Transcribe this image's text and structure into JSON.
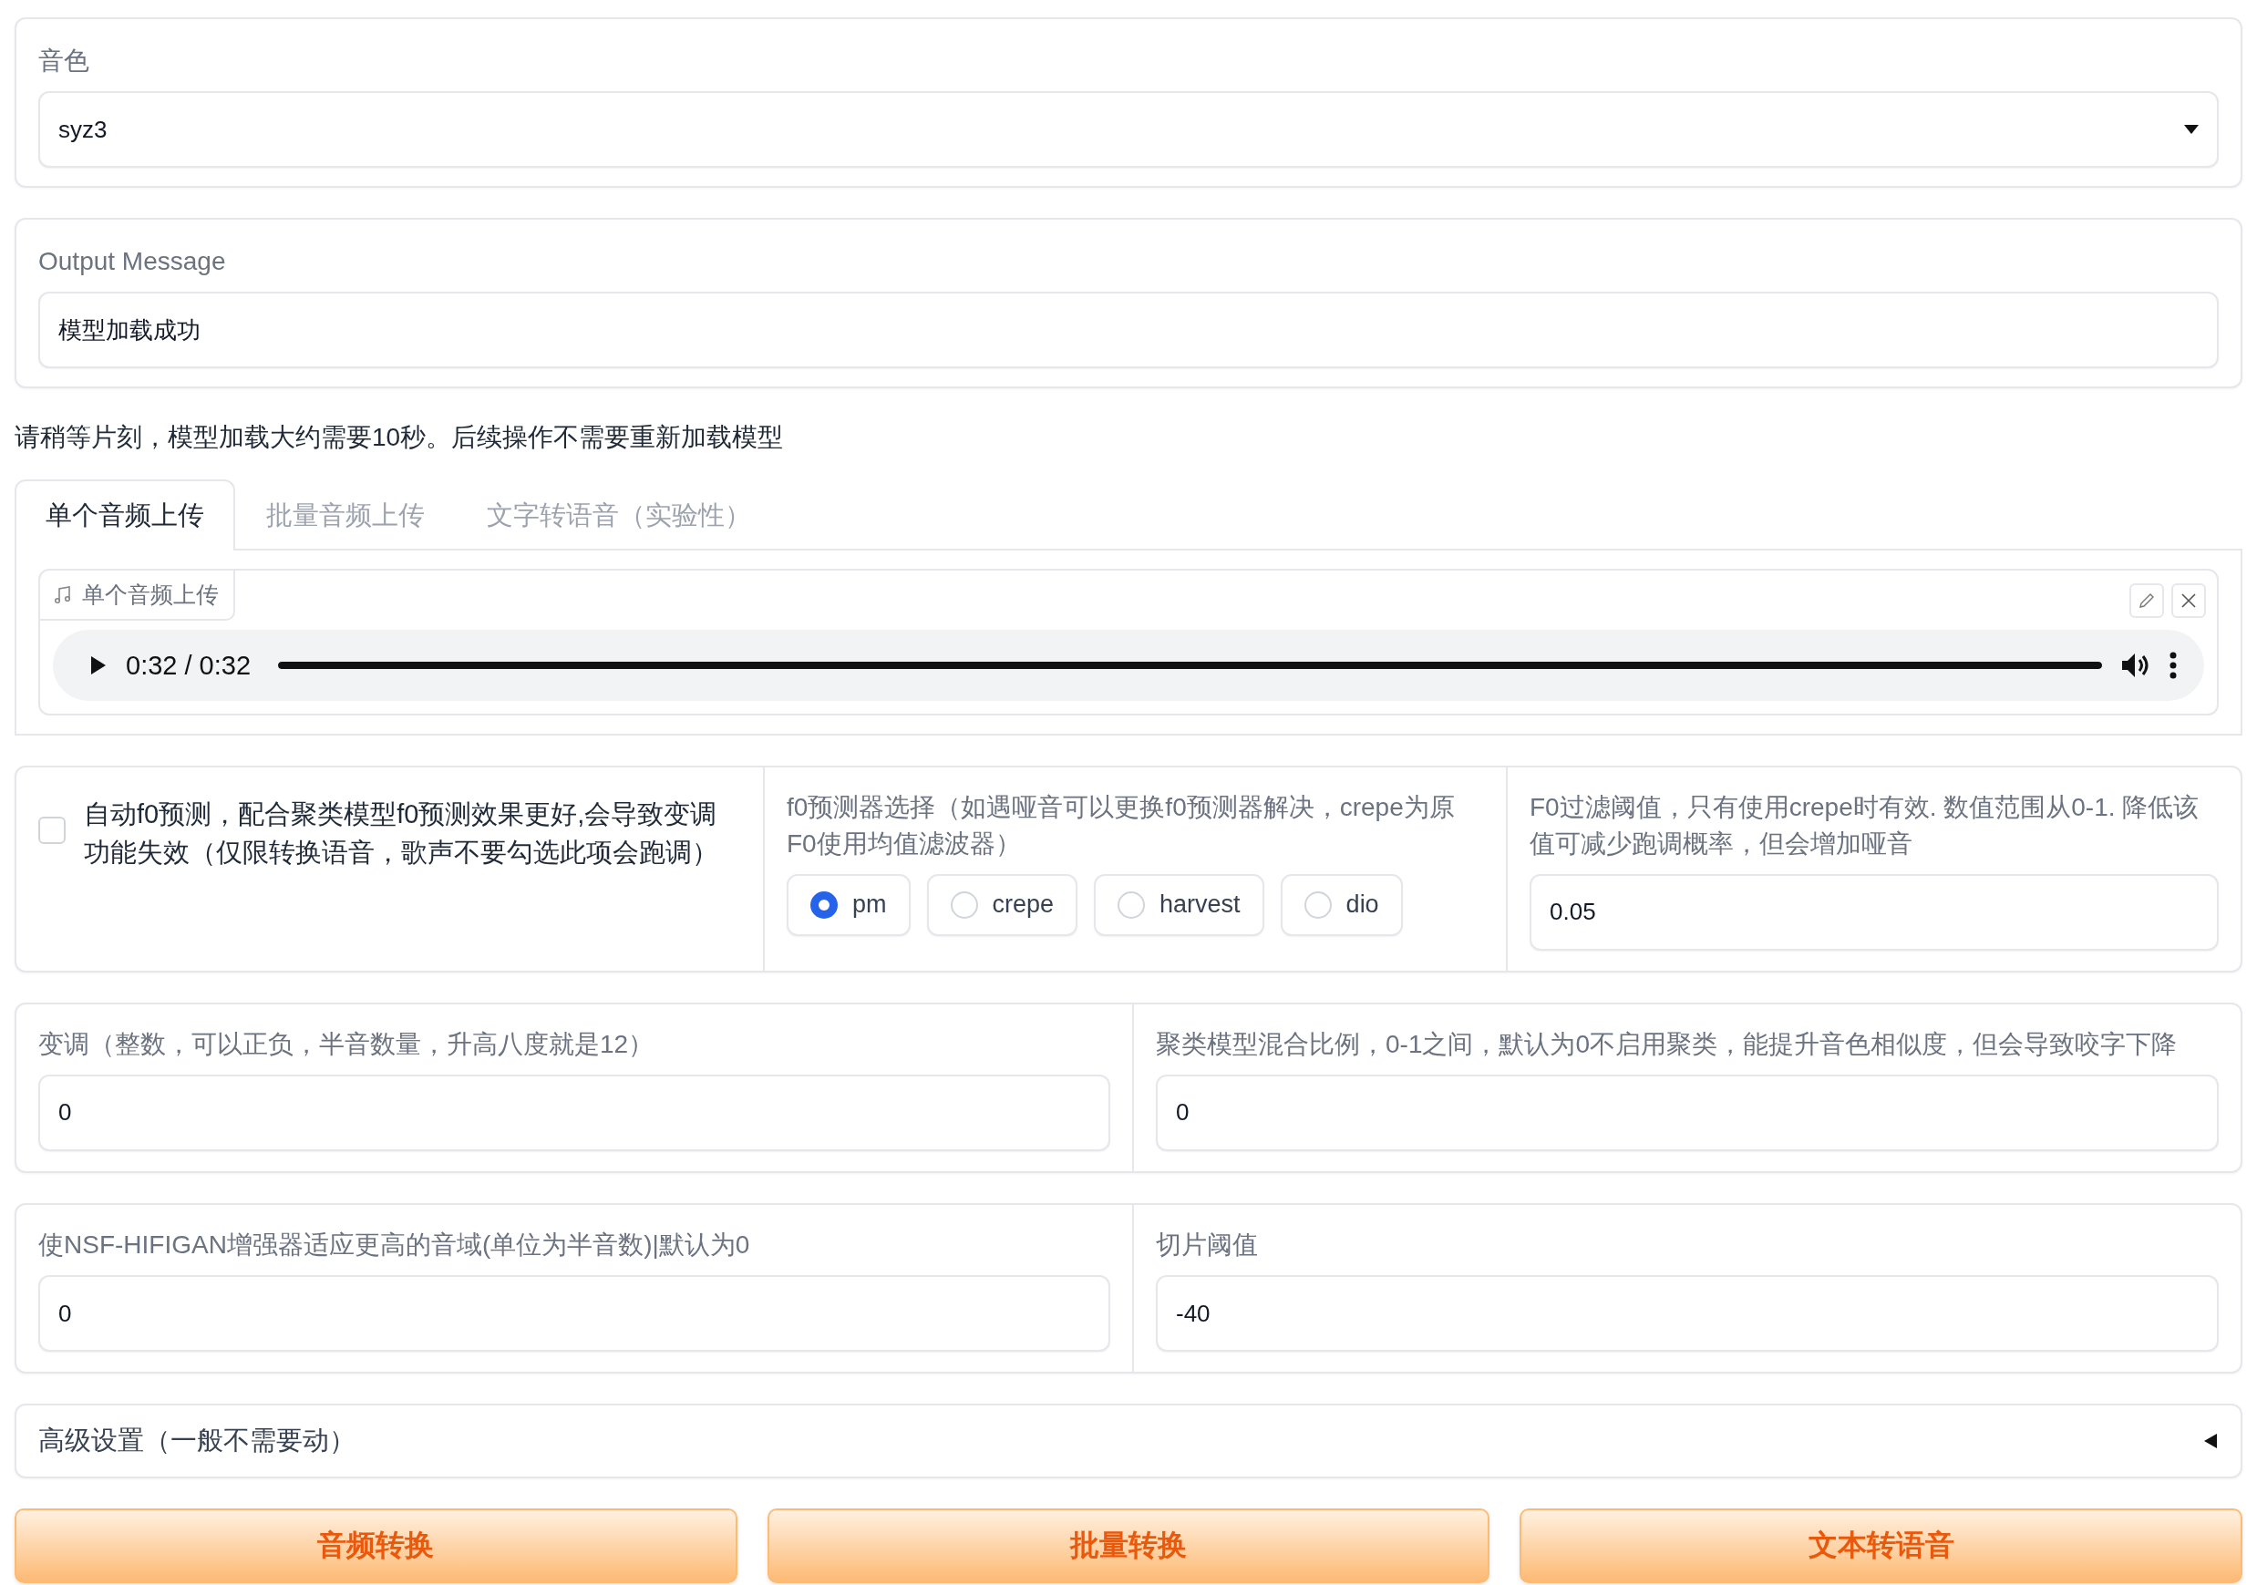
{
  "voice": {
    "label": "音色",
    "value": "syz3"
  },
  "output": {
    "label": "Output Message",
    "value": "模型加载成功"
  },
  "note": "请稍等片刻，模型加载大约需要10秒。后续操作不需要重新加载模型",
  "tabs": [
    {
      "label": "单个音频上传",
      "selected": true
    },
    {
      "label": "批量音频上传",
      "selected": false
    },
    {
      "label": "文字转语音（实验性）",
      "selected": false
    }
  ],
  "audio": {
    "label": "单个音频上传",
    "time": "0:32 / 0:32",
    "level": 1
  },
  "auto_f0": {
    "label": "自动f0预测，配合聚类模型f0预测效果更好,会导致变调功能失效（仅限转换语音，歌声不要勾选此项会跑调）",
    "checked": false
  },
  "f0_detector": {
    "label": "f0预测器选择（如遇哑音可以更换f0预测器解决，crepe为原F0使用均值滤波器）",
    "options": [
      {
        "label": "pm",
        "selected": true
      },
      {
        "label": "crepe",
        "selected": false
      },
      {
        "label": "harvest",
        "selected": false
      },
      {
        "label": "dio",
        "selected": false
      }
    ]
  },
  "f0_threshold": {
    "label": "F0过滤阈值，只有使用crepe时有效. 数值范围从0-1. 降低该值可减少跑调概率，但会增加哑音",
    "value": "0.05"
  },
  "field_rows": [
    [
      {
        "label": "变调（整数，可以正负，半音数量，升高八度就是12）",
        "value": "0"
      },
      {
        "label": "聚类模型混合比例，0-1之间，默认为0不启用聚类，能提升音色相似度，但会导致咬字下降",
        "value": "0"
      }
    ],
    [
      {
        "label": "使NSF-HIFIGAN增强器适应更高的音域(单位为半音数)|默认为0",
        "value": "0"
      },
      {
        "label": "切片阈值",
        "value": "-40"
      }
    ]
  ],
  "advanced": {
    "label": "高级设置（一般不需要动）",
    "expanded": false
  },
  "buttons": [
    "音频转换",
    "批量转换",
    "文本转语音"
  ]
}
